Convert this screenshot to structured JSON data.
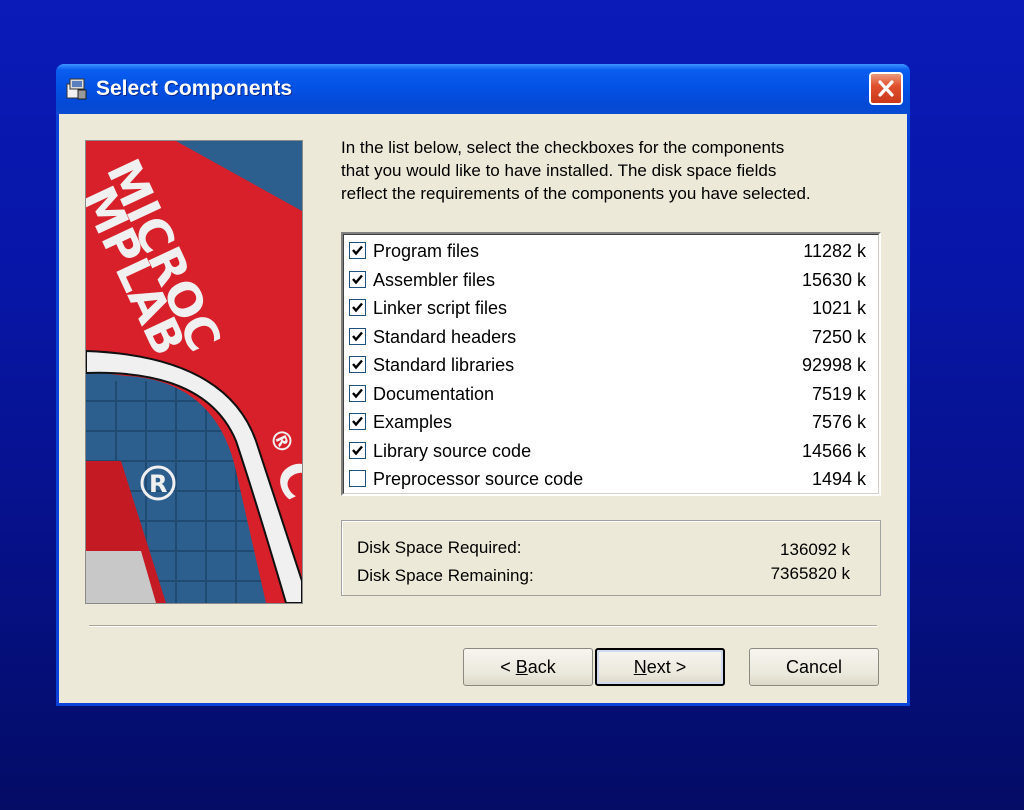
{
  "window": {
    "title": "Select Components",
    "close_icon": "close-icon"
  },
  "logo": {
    "brand_text": "MICROCHIP MPLAB C",
    "colors": {
      "red": "#d8202a",
      "blue": "#2c5f8e",
      "white": "#f0f0f0"
    }
  },
  "instructions": {
    "lines": [
      "In the list below, select the checkboxes for the components",
      "that you would like to have installed.  The disk space fields",
      "reflect the requirements of the components you have selected."
    ]
  },
  "components": [
    {
      "name": "Program files",
      "size": "11282 k",
      "checked": true
    },
    {
      "name": "Assembler files",
      "size": "15630 k",
      "checked": true
    },
    {
      "name": "Linker script files",
      "size": "1021 k",
      "checked": true
    },
    {
      "name": "Standard headers",
      "size": "7250 k",
      "checked": true
    },
    {
      "name": "Standard libraries",
      "size": "92998 k",
      "checked": true
    },
    {
      "name": "Documentation",
      "size": "7519 k",
      "checked": true
    },
    {
      "name": "Examples",
      "size": "7576 k",
      "checked": true
    },
    {
      "name": "Library source code",
      "size": "14566 k",
      "checked": true
    },
    {
      "name": "Preprocessor source code",
      "size": "1494 k",
      "checked": false
    }
  ],
  "disk_space": {
    "required_label": "Disk Space Required:",
    "required_value": "136092 k",
    "remaining_label": "Disk Space Remaining:",
    "remaining_value": "7365820 k"
  },
  "buttons": {
    "back_prefix": "< ",
    "back_mnemonic": "B",
    "back_rest": "ack",
    "next_mnemonic": "N",
    "next_rest": "ext >",
    "cancel": "Cancel"
  }
}
